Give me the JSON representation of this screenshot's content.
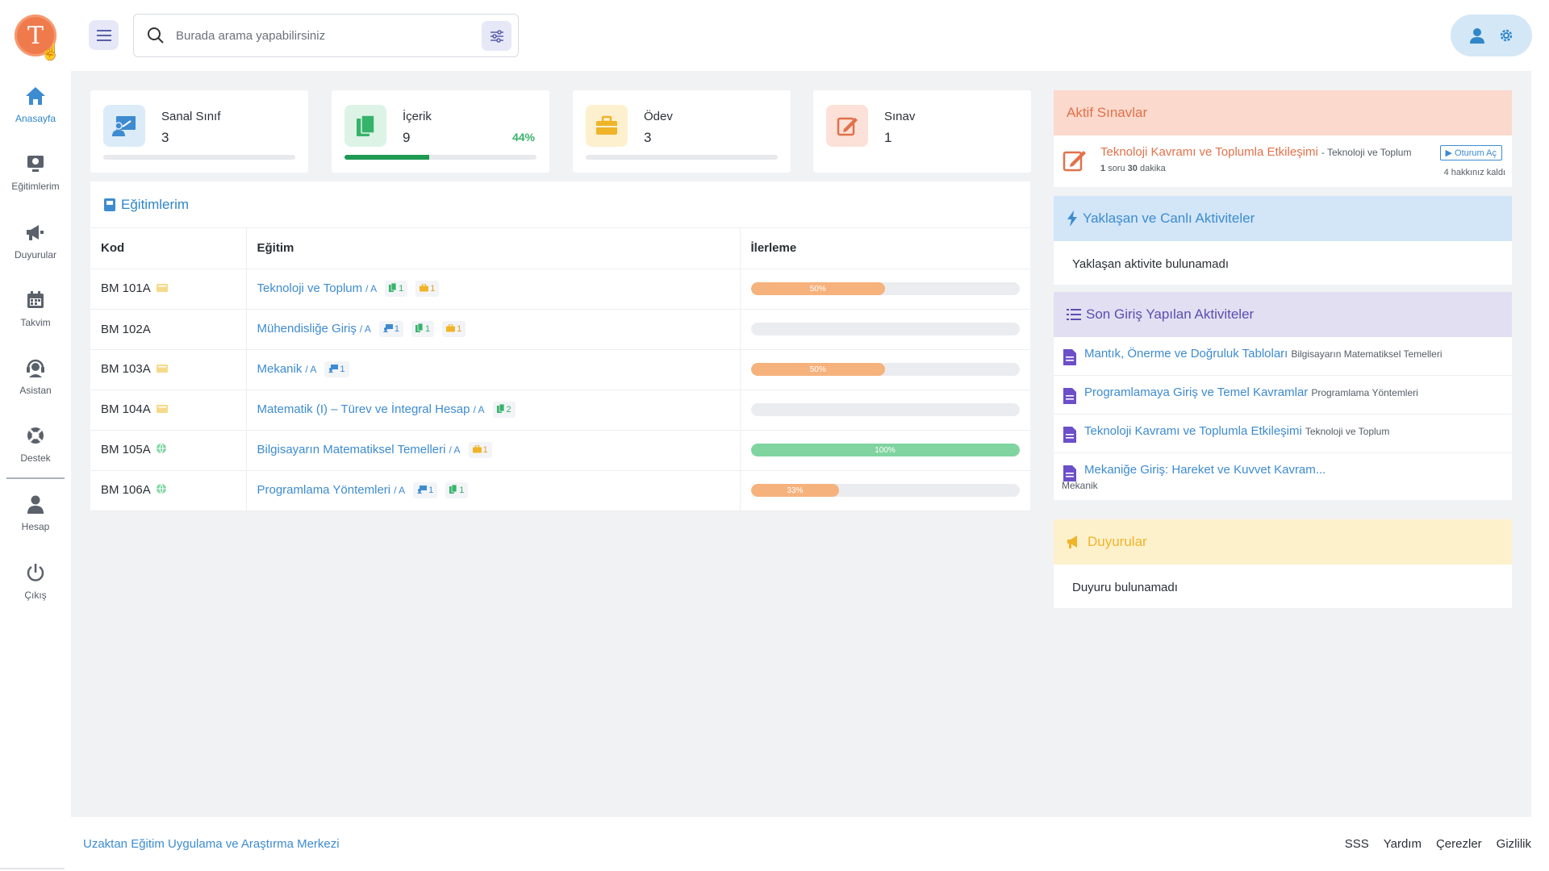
{
  "brand": {
    "logo_letter": "T"
  },
  "sidebar": {
    "items": [
      {
        "label": "Anasayfa",
        "icon": "home-icon",
        "active": true
      },
      {
        "label": "Eğitimlerim",
        "icon": "monitor-icon"
      },
      {
        "label": "Duyurular",
        "icon": "megaphone-icon"
      },
      {
        "label": "Takvim",
        "icon": "calendar-icon"
      },
      {
        "label": "Asistan",
        "icon": "headset-icon"
      },
      {
        "label": "Destek",
        "icon": "lifebuoy-icon"
      },
      {
        "label": "Hesap",
        "icon": "user-icon"
      },
      {
        "label": "Çıkış",
        "icon": "power-icon"
      }
    ]
  },
  "search": {
    "placeholder": "Burada arama yapabilirsiniz"
  },
  "stats": [
    {
      "label": "Sanal Sınıf",
      "value": "3",
      "icon": "virtual-class-icon",
      "color": "#3d8bd0",
      "bg": "#dcebf8",
      "progress": 0
    },
    {
      "label": "İçerik",
      "value": "9",
      "percent": "44%",
      "icon": "content-icon",
      "color": "#36b36a",
      "bg": "#dcf3e6",
      "progress": 0.44
    },
    {
      "label": "Ödev",
      "value": "3",
      "icon": "briefcase-icon",
      "color": "#f0b429",
      "bg": "#fdf0cf",
      "progress": 0
    },
    {
      "label": "Sınav",
      "value": "1",
      "icon": "exam-icon",
      "color": "#e2714a",
      "bg": "#fbe1d8"
    }
  ],
  "courses": {
    "title": "Eğitimlerim",
    "columns": {
      "code": "Kod",
      "course": "Eğitim",
      "progress": "İlerleme"
    },
    "rows": [
      {
        "code": "BM 101A",
        "mode": "classroom",
        "name": "Teknoloji ve Toplum",
        "section": "/ A",
        "tags": [
          {
            "type": "content",
            "count": "1"
          },
          {
            "type": "assignment",
            "count": "1"
          }
        ],
        "progress": 0.5,
        "progress_label": "50%"
      },
      {
        "code": "BM 102A",
        "mode": "none",
        "name": "Mühendisliğe Giriş",
        "section": "/ A",
        "tags": [
          {
            "type": "virtual",
            "count": "1"
          },
          {
            "type": "content",
            "count": "1"
          },
          {
            "type": "assignment",
            "count": "1"
          }
        ],
        "progress": 0,
        "progress_label": ""
      },
      {
        "code": "BM 103A",
        "mode": "classroom",
        "name": "Mekanik",
        "section": "/ A",
        "tags": [
          {
            "type": "virtual",
            "count": "1"
          }
        ],
        "progress": 0.5,
        "progress_label": "50%"
      },
      {
        "code": "BM 104A",
        "mode": "classroom",
        "name": "Matematik (I) – Türev ve İntegral Hesap",
        "section": "/ A",
        "tags": [
          {
            "type": "content",
            "count": "2"
          }
        ],
        "progress": 0,
        "progress_label": ""
      },
      {
        "code": "BM 105A",
        "mode": "online",
        "name": "Bilgisayarın Matematiksel Temelleri",
        "section": "/ A",
        "tags": [
          {
            "type": "assignment",
            "count": "1"
          }
        ],
        "progress": 1.0,
        "progress_label": "100%"
      },
      {
        "code": "BM 106A",
        "mode": "online",
        "name": "Programlama Yöntemleri",
        "section": "/ A",
        "tags": [
          {
            "type": "virtual",
            "count": "1"
          },
          {
            "type": "content",
            "count": "1"
          }
        ],
        "progress": 0.33,
        "progress_label": "33%"
      }
    ]
  },
  "active_exams": {
    "title": "Aktif Sınavlar",
    "exam_title": "Teknoloji Kavramı ve Toplumla Etkileşimi",
    "exam_course": "- Teknoloji ve Toplum",
    "questions": "1",
    "questions_suffix": "soru",
    "minutes": "30",
    "minutes_suffix": "dakika",
    "button": "Oturum Aç",
    "attempts_left": "4 hakkınız kaldı"
  },
  "upcoming": {
    "title": "Yaklaşan ve Canlı Aktiviteler",
    "empty": "Yaklaşan aktivite bulunamadı"
  },
  "recent": {
    "title": "Son Giriş Yapılan Aktiviteler",
    "items": [
      {
        "title": "Mantık, Önerme ve Doğruluk Tabloları",
        "course": "Bilgisayarın Matematiksel Temelleri"
      },
      {
        "title": "Programlamaya Giriş ve Temel Kavramlar",
        "course": "Programlama Yöntemleri"
      },
      {
        "title": "Teknoloji Kavramı ve Toplumla Etkileşimi",
        "course": "Teknoloji ve Toplum"
      },
      {
        "title": "Mekaniğe Giriş: Hareket ve Kuvvet Kavram...",
        "course": "Mekanik"
      }
    ]
  },
  "announcements": {
    "title": "Duyurular",
    "empty": "Duyuru bulunamadı"
  },
  "footer": {
    "org": "Uzaktan Eğitim Uygulama ve Araştırma Merkezi",
    "links": [
      "SSS",
      "Yardım",
      "Çerezler",
      "Gizlilik"
    ]
  },
  "colors": {
    "accent": "#3d8bd0",
    "orange": "#e2714a",
    "green": "#1f9a52",
    "progress_partial": "#f6b27c",
    "progress_full": "#7fd4a0"
  }
}
